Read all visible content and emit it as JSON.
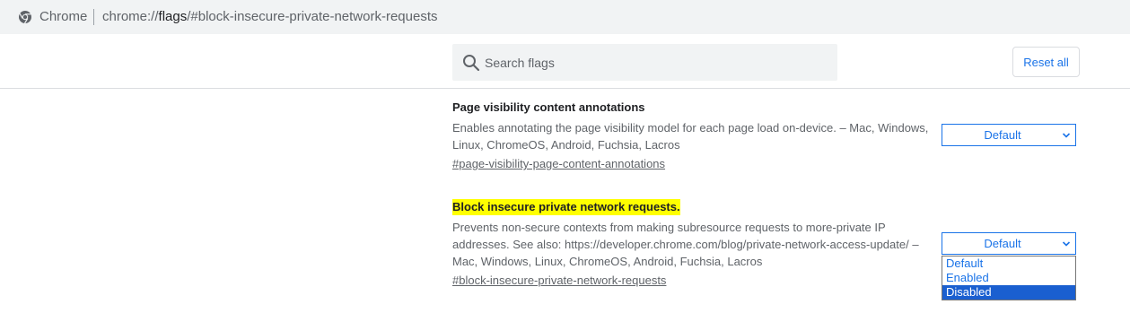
{
  "omnibox": {
    "site_label": "Chrome",
    "url_scheme": "chrome://",
    "url_host": "flags",
    "url_rest": "/#block-insecure-private-network-requests"
  },
  "toolbar": {
    "search_placeholder": "Search flags",
    "search_value": "",
    "reset_label": "Reset all"
  },
  "flags": [
    {
      "title": "Page visibility content annotations",
      "description": "Enables annotating the page visibility model for each page load on-device. – Mac, Windows, Linux, ChromeOS, Android, Fuchsia, Lacros",
      "link": "#page-visibility-page-content-annotations",
      "selected_value": "Default"
    },
    {
      "title": "Block insecure private network requests.",
      "description": "Prevents non-secure contexts from making subresource requests to more-private IP addresses. See also: https://developer.chrome.com/blog/private-network-access-update/ – Mac, Windows, Linux, ChromeOS, Android, Fuchsia, Lacros",
      "link": "#block-insecure-private-network-requests",
      "selected_value": "Default",
      "highlighted": true
    }
  ],
  "dropdown": {
    "options": [
      "Default",
      "Enabled",
      "Disabled"
    ],
    "hovered_option": "Disabled"
  },
  "colors": {
    "accent": "#1a73e8",
    "highlight": "#ffff00",
    "dropdown_selected": "#1a5fd0"
  }
}
